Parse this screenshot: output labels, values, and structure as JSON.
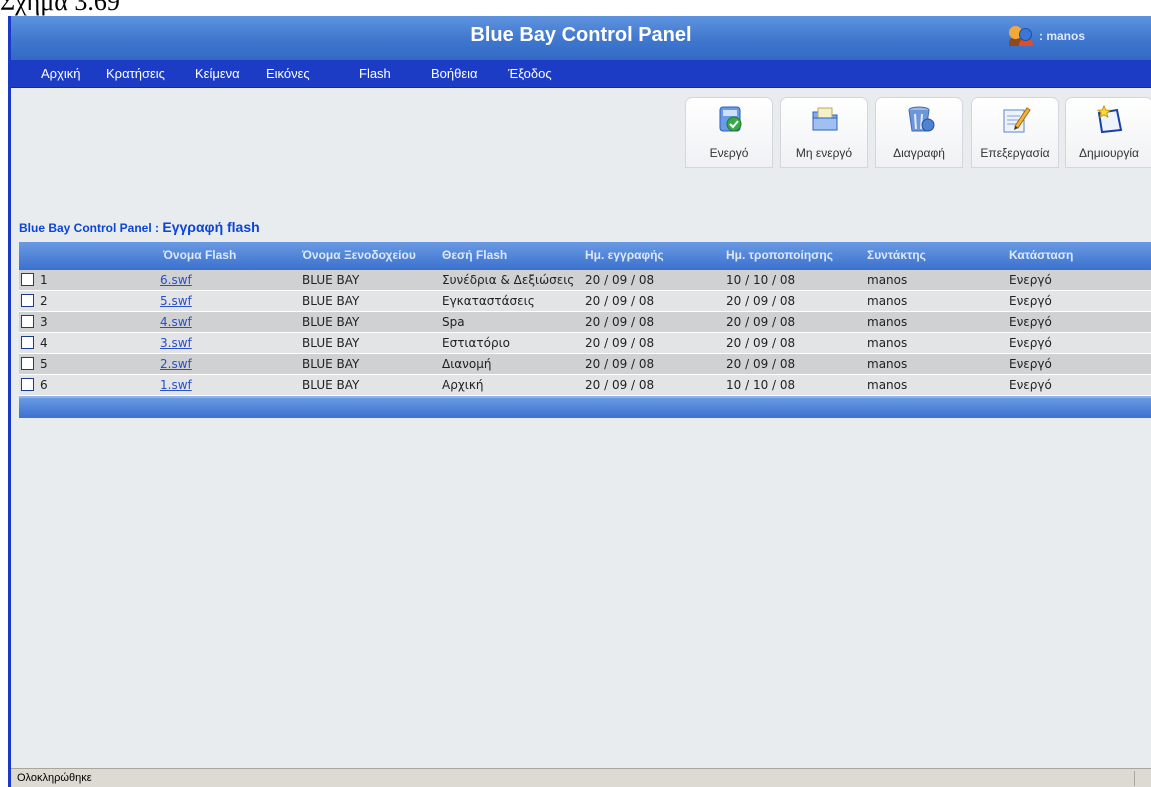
{
  "caption": "Σχήμα 3.69",
  "app": {
    "title": "Blue Bay Control Panel",
    "user_label": ": manos"
  },
  "menu": [
    {
      "label": "Αρχική"
    },
    {
      "label": "Κρατήσεις"
    },
    {
      "label": "Κείμενα"
    },
    {
      "label": "Εικόνες"
    },
    {
      "label": "Flash"
    },
    {
      "label": "Βοήθεια"
    },
    {
      "label": "Έξοδος"
    }
  ],
  "toolbar": [
    {
      "label": "Ενεργό",
      "icon": "activate-icon"
    },
    {
      "label": "Μη ενεργό",
      "icon": "deactivate-icon"
    },
    {
      "label": "Διαγραφή",
      "icon": "recycle-bin-icon"
    },
    {
      "label": "Επεξεργασία",
      "icon": "edit-icon"
    },
    {
      "label": "Δημιουργία",
      "icon": "create-icon"
    }
  ],
  "section": {
    "prefix": "Blue Bay Control Panel :",
    "subtitle": "Εγγραφή flash"
  },
  "table": {
    "headers": [
      "Όνομα Flash",
      "Όνομα Ξενοδοχείου",
      "Θεσή Flash",
      "Ημ. εγγραφής",
      "Ημ. τροποποίησης",
      "Συντάκτης",
      "Κατάσταση"
    ],
    "rows": [
      {
        "num": "1",
        "flash": "6.swf",
        "hotel": "BLUE BAY",
        "position": "Συνέδρια & Δεξιώσεις",
        "created": "20 / 09 / 08",
        "modified": "10 / 10 / 08",
        "author": "manos",
        "status": "Ενεργό"
      },
      {
        "num": "2",
        "flash": "5.swf",
        "hotel": "BLUE BAY",
        "position": "Εγκαταστάσεις",
        "created": "20 / 09 / 08",
        "modified": "20 / 09 / 08",
        "author": "manos",
        "status": "Ενεργό"
      },
      {
        "num": "3",
        "flash": "4.swf",
        "hotel": "BLUE BAY",
        "position": "Spa",
        "created": "20 / 09 / 08",
        "modified": "20 / 09 / 08",
        "author": "manos",
        "status": "Ενεργό"
      },
      {
        "num": "4",
        "flash": "3.swf",
        "hotel": "BLUE BAY",
        "position": "Εστιατόριο",
        "created": "20 / 09 / 08",
        "modified": "20 / 09 / 08",
        "author": "manos",
        "status": "Ενεργό"
      },
      {
        "num": "5",
        "flash": "2.swf",
        "hotel": "BLUE BAY",
        "position": "Διανομή",
        "created": "20 / 09 / 08",
        "modified": "20 / 09 / 08",
        "author": "manos",
        "status": "Ενεργό"
      },
      {
        "num": "6",
        "flash": "1.swf",
        "hotel": "BLUE BAY",
        "position": "Αρχική",
        "created": "20 / 09 / 08",
        "modified": "10 / 10 / 08",
        "author": "manos",
        "status": "Ενεργό"
      }
    ]
  },
  "status_bar": {
    "text": "Ολοκληρώθηκε"
  }
}
